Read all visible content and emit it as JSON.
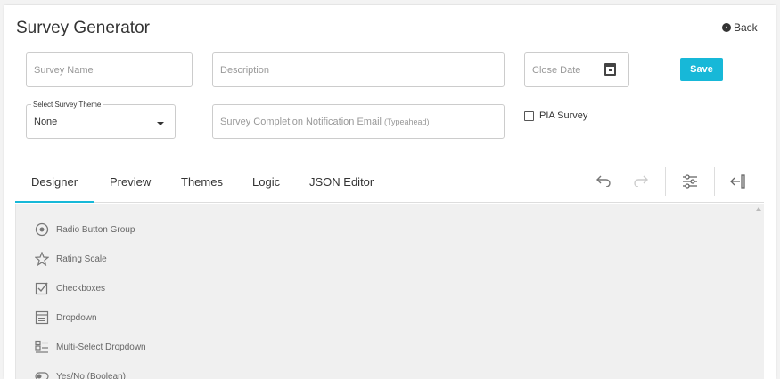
{
  "header": {
    "title": "Survey Generator",
    "back_label": "Back"
  },
  "form": {
    "survey_name_placeholder": "Survey Name",
    "description_placeholder": "Description",
    "close_date_placeholder": "Close Date",
    "save_label": "Save",
    "theme_label": "Select Survey Theme",
    "theme_value": "None",
    "notification_placeholder": "Survey Completion Notification Email",
    "notification_hint": "(Typeahead)",
    "pia_label": "PIA Survey"
  },
  "tabs": [
    "Designer",
    "Preview",
    "Themes",
    "Logic",
    "JSON Editor"
  ],
  "toolbox": [
    {
      "label": "Radio Button Group",
      "icon": "radio-group-icon"
    },
    {
      "label": "Rating Scale",
      "icon": "star-icon"
    },
    {
      "label": "Checkboxes",
      "icon": "checkbox-icon"
    },
    {
      "label": "Dropdown",
      "icon": "dropdown-icon"
    },
    {
      "label": "Multi-Select Dropdown",
      "icon": "multiselect-icon"
    },
    {
      "label": "Yes/No (Boolean)",
      "icon": "boolean-icon"
    }
  ],
  "colors": {
    "accent": "#17b8d8",
    "panel": "#f0f0f0"
  }
}
